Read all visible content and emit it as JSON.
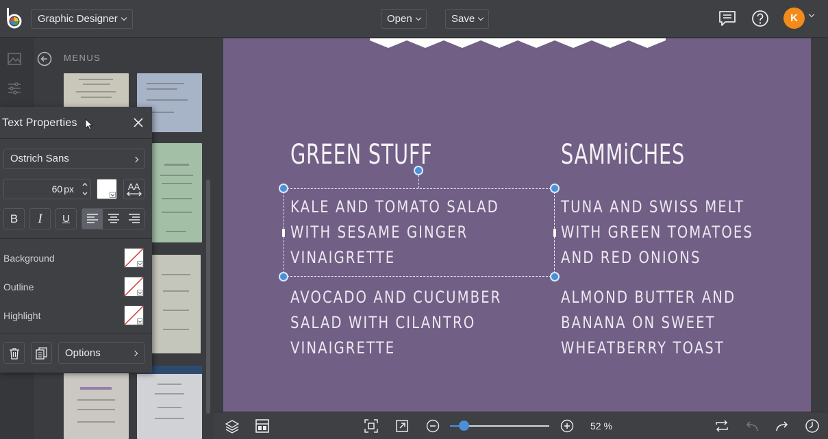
{
  "header": {
    "mode_label": "Graphic Designer",
    "open_label": "Open",
    "save_label": "Save",
    "avatar_initial": "K"
  },
  "sidebar": {
    "title": "MENUS"
  },
  "artboard": {
    "col1_heading": "GREEN STUFF",
    "col2_heading": "SAMMiCHES",
    "col1_items": [
      "KALE AND TOMATO SALAD",
      "WITH SESAME GINGER",
      "VINAIGRETTE",
      "AVOCADO AND CUCUMBER",
      "SALAD WITH CILANTRO",
      "VINAIGRETTE"
    ],
    "col2_items": [
      "TUNA AND SWISS MELT",
      "WITH GREEN TOMATOES",
      "AND RED ONIONS",
      "ALMOND BUTTER AND",
      "BANANA ON SWEET",
      "WHEATBERRY TOAST"
    ],
    "background_color": "#715f85"
  },
  "text_properties": {
    "title": "Text Properties",
    "font": "Ostrich Sans",
    "size_value": "60",
    "size_unit": "px",
    "aa_label": "AA",
    "bold_label": "B",
    "italic_label": "I",
    "underline_label": "U",
    "background_label": "Background",
    "outline_label": "Outline",
    "highlight_label": "Highlight",
    "options_label": "Options"
  },
  "bottombar": {
    "zoom": "52",
    "zoom_unit": "%",
    "zoom_fraction": 0.14
  },
  "colors": {
    "accent": "#4a90d9",
    "avatar": "#f28b1a"
  }
}
